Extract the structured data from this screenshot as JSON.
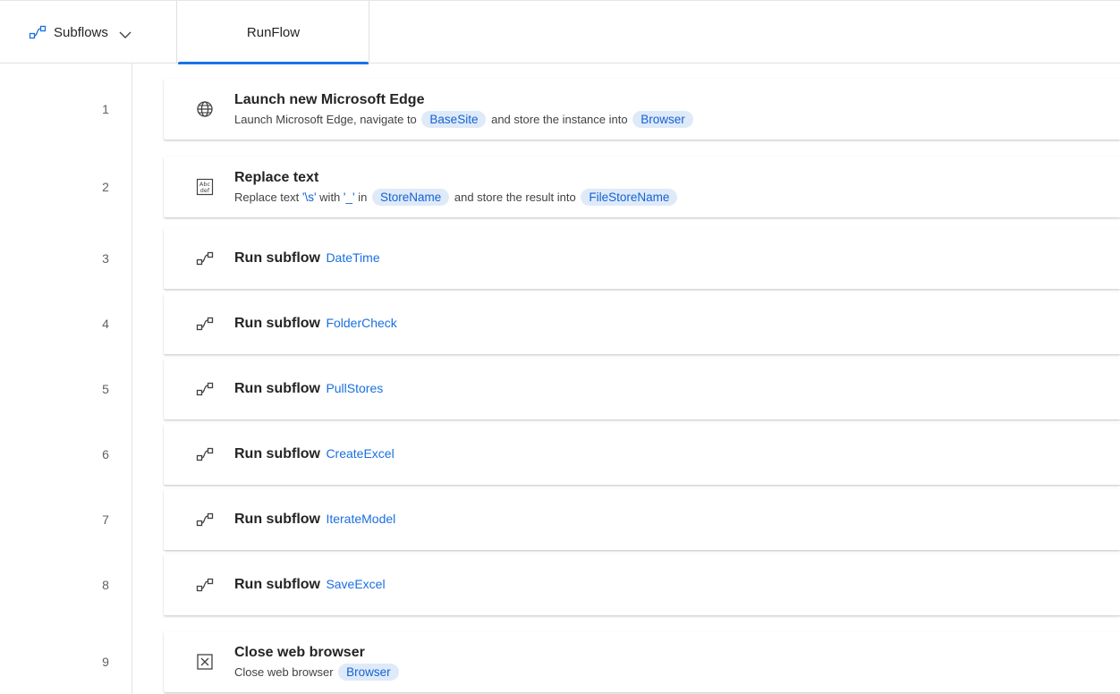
{
  "toolbar": {
    "subflows_label": "Subflows",
    "tab_label": "RunFlow"
  },
  "steps": [
    {
      "number": "1",
      "title": "Launch new Microsoft Edge",
      "desc_1": "Launch Microsoft Edge, navigate to",
      "chip_1": "BaseSite",
      "desc_2": "and store the instance into",
      "chip_2": "Browser"
    },
    {
      "number": "2",
      "title": "Replace text",
      "desc_1": "Replace text",
      "lit_1": "'\\s'",
      "desc_2": "with",
      "lit_2": "'_'",
      "desc_3": "in",
      "chip_1": "StoreName",
      "desc_4": "and store the result into",
      "chip_2": "FileStoreName"
    },
    {
      "number": "3",
      "title": "Run subflow",
      "subflow": "DateTime"
    },
    {
      "number": "4",
      "title": "Run subflow",
      "subflow": "FolderCheck"
    },
    {
      "number": "5",
      "title": "Run subflow",
      "subflow": "PullStores"
    },
    {
      "number": "6",
      "title": "Run subflow",
      "subflow": "CreateExcel"
    },
    {
      "number": "7",
      "title": "Run subflow",
      "subflow": "IterateModel"
    },
    {
      "number": "8",
      "title": "Run subflow",
      "subflow": "SaveExcel"
    },
    {
      "number": "9",
      "title": "Close web browser",
      "desc_1": "Close web browser",
      "chip_1": "Browser"
    }
  ],
  "colors": {
    "accent": "#1a73e8",
    "chip_bg": "#dfeaf9",
    "chip_text": "#1462d2"
  },
  "icons": {
    "subflows": "subflow-icon",
    "chevron": "chevron-down-icon",
    "step_1": "globe-icon",
    "step_2": "text-abc-icon",
    "step_run_subflow": "subflow-icon",
    "step_9": "close-box-icon"
  }
}
